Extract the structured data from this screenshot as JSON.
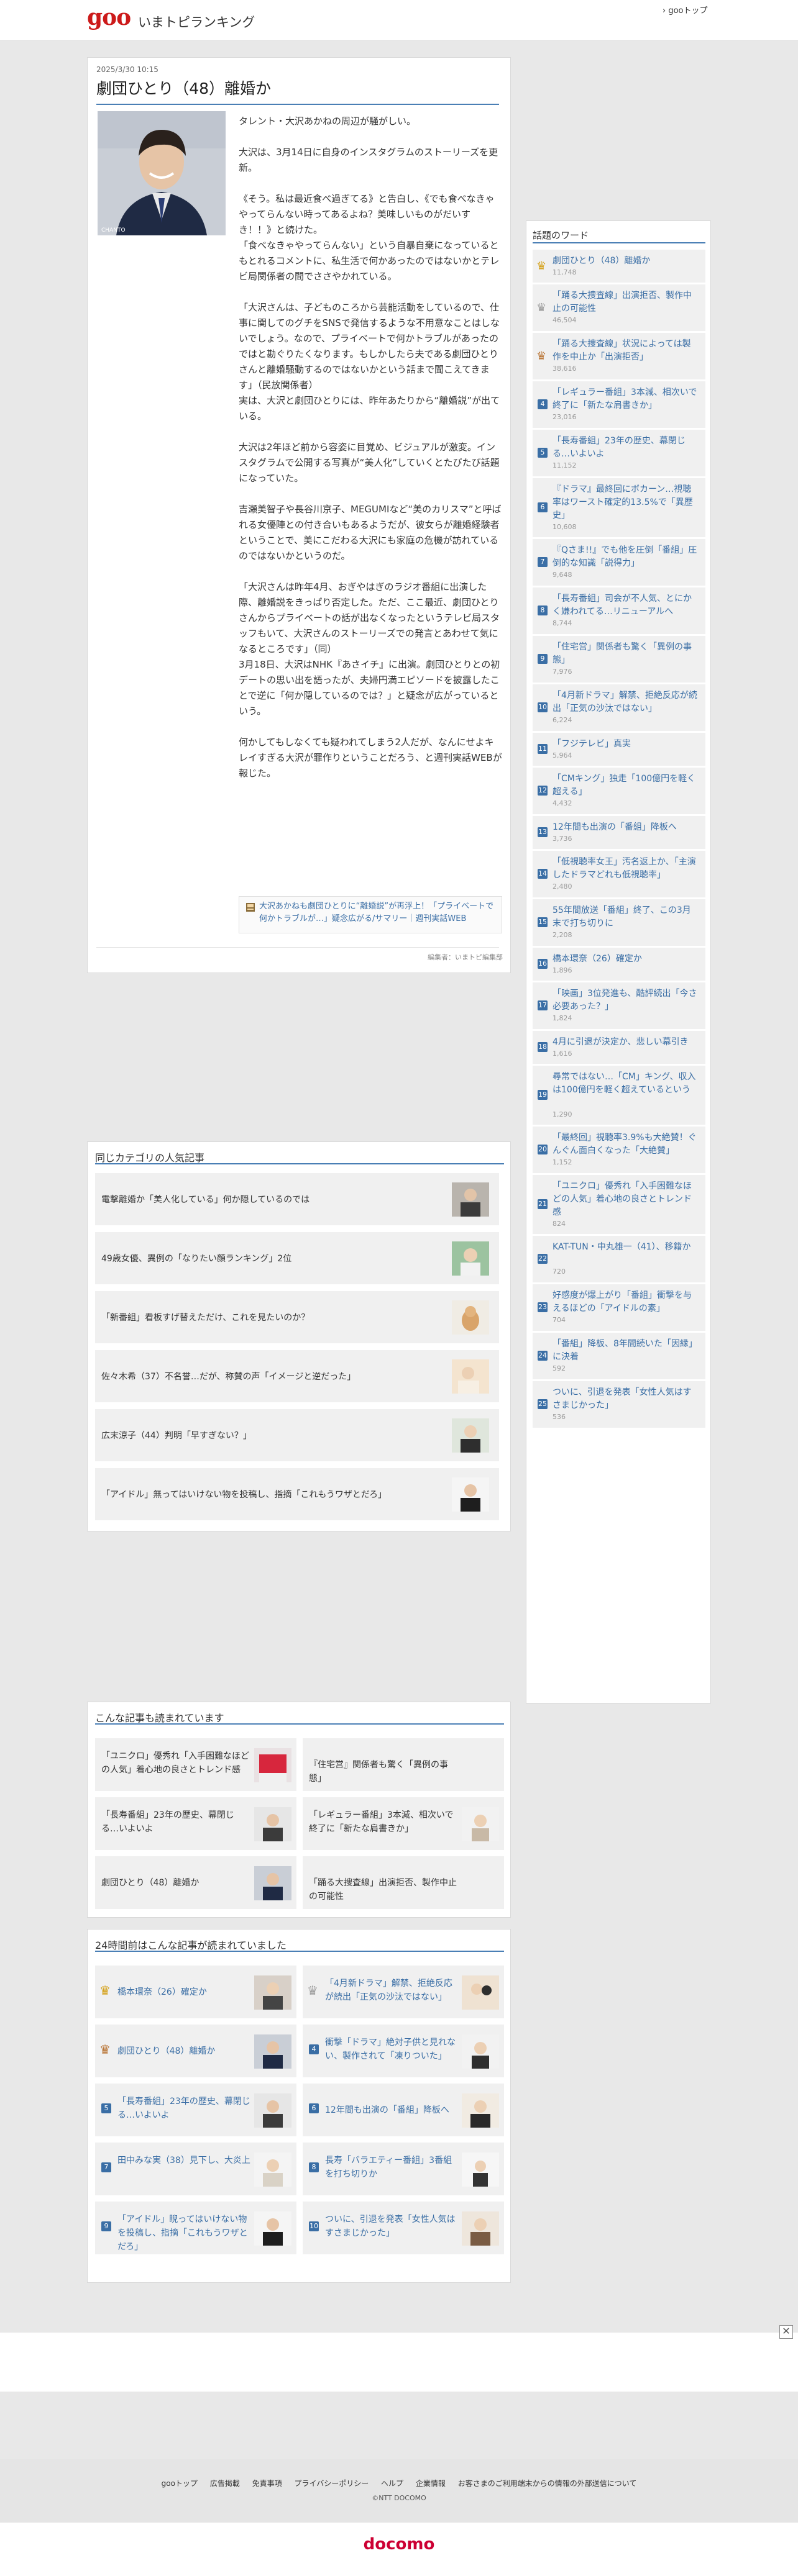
{
  "header": {
    "logo": "goo",
    "site_name": "いまトピランキング",
    "goo_top_link": "› gooトップ"
  },
  "article": {
    "date": "2025/3/30 10:15",
    "title": "劇団ひとり（48）離婚か",
    "photo_caption": "CHANTO",
    "paragraphs": [
      "タレント・大沢あかねの周辺が騒がしい。",
      "大沢は、3月14日に自身のインスタグラムのストーリーズを更新。",
      "《そう。私は最近食べ過ぎてる》と告白し、《でも食べなきゃやってらんない時ってあるよね？美味しいものがだいすき！！》と続けた。\n「食べなきゃやってらんない」という自暴自棄になっているともとれるコメントに、私生活で何かあったのではないかとテレビ局関係者の間でささやかれている。",
      "「大沢さんは、子どものころから芸能活動をしているので、仕事に関してのグチをSNSで発信するような不用意なことはしないでしょう。なので、プライベートで何かトラブルがあったのではと勘ぐりたくなります。もしかしたら夫である劇団ひとりさんと離婚騒動するのではないかという話まで聞こえてきます」（民放関係者）\n実は、大沢と劇団ひとりには、昨年あたりから“離婚説”が出ている。",
      "大沢は2年ほど前から容姿に目覚め、ビジュアルが激変。インスタグラムで公開する写真が“美人化”していくとたびたび話題になっていた。",
      "吉瀬美智子や長谷川京子、MEGUMIなど“美のカリスマ”と呼ばれる女優陣との付き合いもあるようだが、彼女らが離婚経験者ということで、美にこだわる大沢にも家庭の危機が訪れているのではないかというのだ。",
      "「大沢さんは昨年4月、おぎやはぎのラジオ番組に出演した際、離婚説をきっぱり否定した。ただ、ここ最近、劇団ひとりさんからプライベートの話が出なくなったというテレビ局スタッフもいて、大沢さんのストーリーズでの発言とあわせて気になるところです」（同）\n3月18日、大沢はNHK『あさイチ』に出演。劇団ひとりとの初デートの思い出を語ったが、夫婦円満エピソードを披露したことで逆に「何か隠しているのでは？」と疑念が広がっているという。",
      "何かしてもしなくても疑われてしまう2人だが、なんにせよキレイすぎる大沢が罪作りということだろう、と週刊実話WEBが報じた。"
    ],
    "related_link": "大沢あかねも劇団ひとりに“離婚説”が再浮上！「プライベートで何かトラブルが…」疑念広がる/サマリー｜週刊実話WEB",
    "editor": "編集者：いまトピ編集部"
  },
  "category": {
    "title": "同じカテゴリの人気記事",
    "items": [
      "電撃離婚か「美人化している」何か隠しているのでは",
      "49歳女優、異例の「なりたい顔ランキング」2位",
      "「新番組」看板すげ替えただけ、これを見たいのか？",
      "佐々木希（37）不名誉…だが、称賛の声「イメージと逆だった」",
      "広末涼子（44）判明「早すぎない？」",
      "「アイドル」無ってはいけない物を投稿し、指摘「これもうワザとだろ」"
    ]
  },
  "recommended": {
    "title": "こんな記事も読まれています",
    "items": [
      "「ユニクロ」優秀れ「入手困難なほどの人気」着心地の良さとトレンド感",
      "『住宅営』関係者も驚く「異例の事態」",
      "「長寿番組」23年の歴史、幕閉じる…いよいよ",
      "「レギュラー番組」3本減、相次いで終了に「新たな肩書きか」",
      "劇団ひとり（48）離婚か",
      "「踊る大捜査線」出演拒否、製作中止の可能性"
    ]
  },
  "ranking24": {
    "title": "24時間前はこんな記事が読まれていました",
    "items": [
      {
        "rank": "1",
        "text": "橋本環奈（26）確定か"
      },
      {
        "rank": "2",
        "text": "「4月新ドラマ」解禁、拒絶反応が続出「正気の沙汰ではない」"
      },
      {
        "rank": "3",
        "text": "劇団ひとり（48）離婚か"
      },
      {
        "rank": "4",
        "text": "衝撃「ドラマ」絶対子供と見れない、製作されて「凍りついた」"
      },
      {
        "rank": "5",
        "text": "「長寿番組」23年の歴史、幕閉じる…いよいよ"
      },
      {
        "rank": "6",
        "text": "12年間も出演の「番組」降板へ"
      },
      {
        "rank": "7",
        "text": "田中みな実（38）見下し、大炎上"
      },
      {
        "rank": "8",
        "text": "長寿「バラエティー番組」3番組を打ち切りか"
      },
      {
        "rank": "9",
        "text": "「アイドル」睨ってはいけない物を投稿し、指摘「これもうワザとだろ」"
      },
      {
        "rank": "10",
        "text": "ついに、引退を発表「女性人気はすさまじかった」"
      }
    ]
  },
  "sidebar": {
    "title": "話題のワード",
    "items": [
      {
        "rank": "1",
        "text": "劇団ひとり（48）離婚か",
        "count": "11,748"
      },
      {
        "rank": "2",
        "text": "「踊る大捜査線」出演拒否、製作中止の可能性",
        "count": "46,504"
      },
      {
        "rank": "3",
        "text": "「踊る大捜査線」状況によっては製作を中止か「出演拒否」",
        "count": "38,616"
      },
      {
        "rank": "4",
        "text": "「レギュラー番組」3本減、相次いで終了に「新たな肩書きか」",
        "count": "23,016"
      },
      {
        "rank": "5",
        "text": "「長寿番組」23年の歴史、幕閉じる…いよいよ",
        "count": "11,152"
      },
      {
        "rank": "6",
        "text": "『ドラマ』最終回にボカーン…視聴率はワースト確定的13.5%で「異歴史」",
        "count": "10,608"
      },
      {
        "rank": "7",
        "text": "『Qさま!!』でも他を圧倒「番組」圧倒的な知識「説得力」",
        "count": "9,648"
      },
      {
        "rank": "8",
        "text": "「長寿番組」司会が不人気、とにかく嫌われてる…リニューアルへ",
        "count": "8,744"
      },
      {
        "rank": "9",
        "text": "「住宅営」関係者も驚く「異例の事態」",
        "count": "7,976"
      },
      {
        "rank": "10",
        "text": "「4月新ドラマ」解禁、拒絶反応が続出「正気の沙汰ではない」",
        "count": "6,224"
      },
      {
        "rank": "11",
        "text": "「フジテレビ」真実",
        "count": "5,964"
      },
      {
        "rank": "12",
        "text": "「CMキング」独走「100億円を軽く超える」",
        "count": "4,432"
      },
      {
        "rank": "13",
        "text": "12年間も出演の「番組」降板へ",
        "count": "3,736"
      },
      {
        "rank": "14",
        "text": "「低視聴率女王」汚名返上か、「主演したドラマどれも低視聴率」",
        "count": "2,480"
      },
      {
        "rank": "15",
        "text": "55年間放送「番組」終了、この3月末で打ち切りに",
        "count": "2,208"
      },
      {
        "rank": "16",
        "text": "橋本環奈（26）確定か",
        "count": "1,896"
      },
      {
        "rank": "17",
        "text": "「映画」3位発進も、酷評続出「今さ必要あった？」",
        "count": "1,824"
      },
      {
        "rank": "18",
        "text": "4月に引退が決定か、悲しい幕引き",
        "count": "1,616"
      },
      {
        "rank": "19",
        "text": "尋常ではない…「CM」キング、収入は100億円を軽く超えているという",
        "count": "1,290"
      },
      {
        "rank": "20",
        "text": "「最終回」視聴率3.9%も大絶賛！ぐんぐん面白くなった「大絶賛」",
        "count": "1,152"
      },
      {
        "rank": "21",
        "text": "「ユニクロ」優秀れ「入手困難なほどの人気」着心地の良さとトレンド感",
        "count": "824"
      },
      {
        "rank": "22",
        "text": "KAT-TUN・中丸雄一（41）、移籍か",
        "count": "720"
      },
      {
        "rank": "23",
        "text": "好感度が爆上がり「番組」衝撃を与えるほどの「アイドルの素」",
        "count": "704"
      },
      {
        "rank": "24",
        "text": "「番組」降板、8年間続いた「因縁」に決着",
        "count": "592"
      },
      {
        "rank": "25",
        "text": "ついに、引退を発表「女性人気はすさまじかった」",
        "count": "536"
      }
    ]
  },
  "ad": {
    "close": "✕"
  },
  "footer": {
    "links": [
      "gooトップ",
      "広告掲載",
      "免責事項",
      "プライバシーポリシー",
      "ヘルプ",
      "企業情報",
      "お客さまのご利用端末からの情報の外部送信について"
    ],
    "copyright": "©NTT DOCOMO",
    "brand": "docomo"
  },
  "colors": {
    "accent": "#4a7fb5",
    "logo": "#cc1a1a",
    "brand": "#cc0033"
  }
}
